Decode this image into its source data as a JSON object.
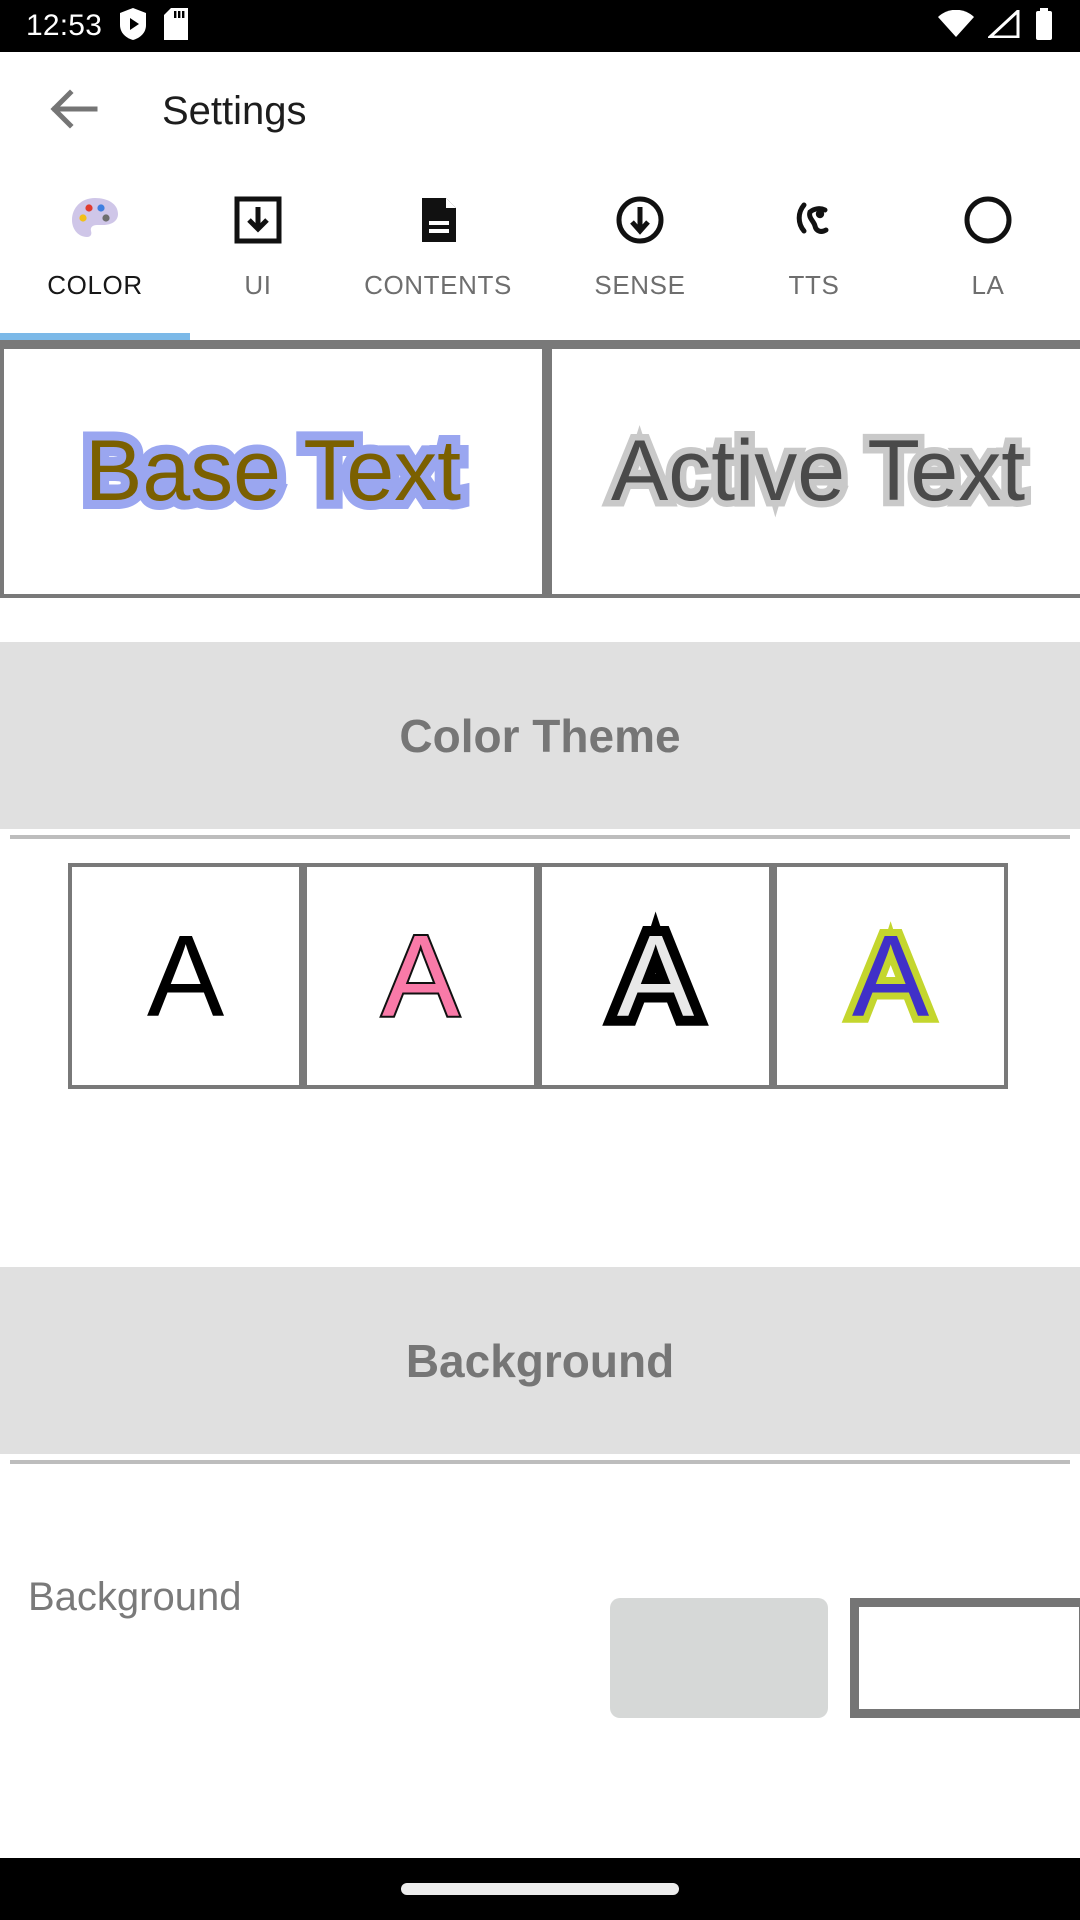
{
  "status_bar": {
    "clock": "12:53",
    "left_icons": [
      "protect-shield-play-icon",
      "sd-card-icon"
    ],
    "right_icons": [
      "wifi-icon",
      "cell-signal-icon",
      "battery-icon"
    ]
  },
  "app_bar": {
    "back_icon": "back-arrow-icon",
    "title": "Settings"
  },
  "tabs": {
    "indicator_color": "#7cb9e8",
    "items": [
      {
        "label": "COLOR",
        "icon": "palette-icon",
        "active": true
      },
      {
        "label": "UI",
        "icon": "download-box-icon",
        "active": false
      },
      {
        "label": "CONTENTS",
        "icon": "document-icon",
        "active": false
      },
      {
        "label": "SENSE",
        "icon": "arrow-down-circle-icon",
        "active": false
      },
      {
        "label": "TTS",
        "icon": "ear-hearing-icon",
        "active": false
      },
      {
        "label": "LA",
        "icon": "language-icon",
        "active": false
      }
    ]
  },
  "preview": {
    "base": {
      "text": "Base Text",
      "fill_color": "#7b6000",
      "outline_color": "#9aa6f0"
    },
    "active": {
      "text": "Active Text",
      "fill_color": "#4a4a4a",
      "outline_color": "#c9c9c9"
    }
  },
  "sections": {
    "color_theme": {
      "title": "Color Theme",
      "swatches": [
        {
          "glyph": "A",
          "fill_color": "#000000",
          "outline_color": "none"
        },
        {
          "glyph": "A",
          "fill_color": "#f97aa8",
          "outline_color": "#111111"
        },
        {
          "glyph": "A",
          "fill_color": "#e8e8e8",
          "outline_color": "#000000"
        },
        {
          "glyph": "A",
          "fill_color": "#4030c8",
          "outline_color": "#c4d62e"
        }
      ]
    },
    "background": {
      "title": "Background",
      "rows": [
        {
          "label": "Background"
        }
      ]
    }
  },
  "nav_bar": {
    "gesture_pill": "home-gesture-pill"
  }
}
